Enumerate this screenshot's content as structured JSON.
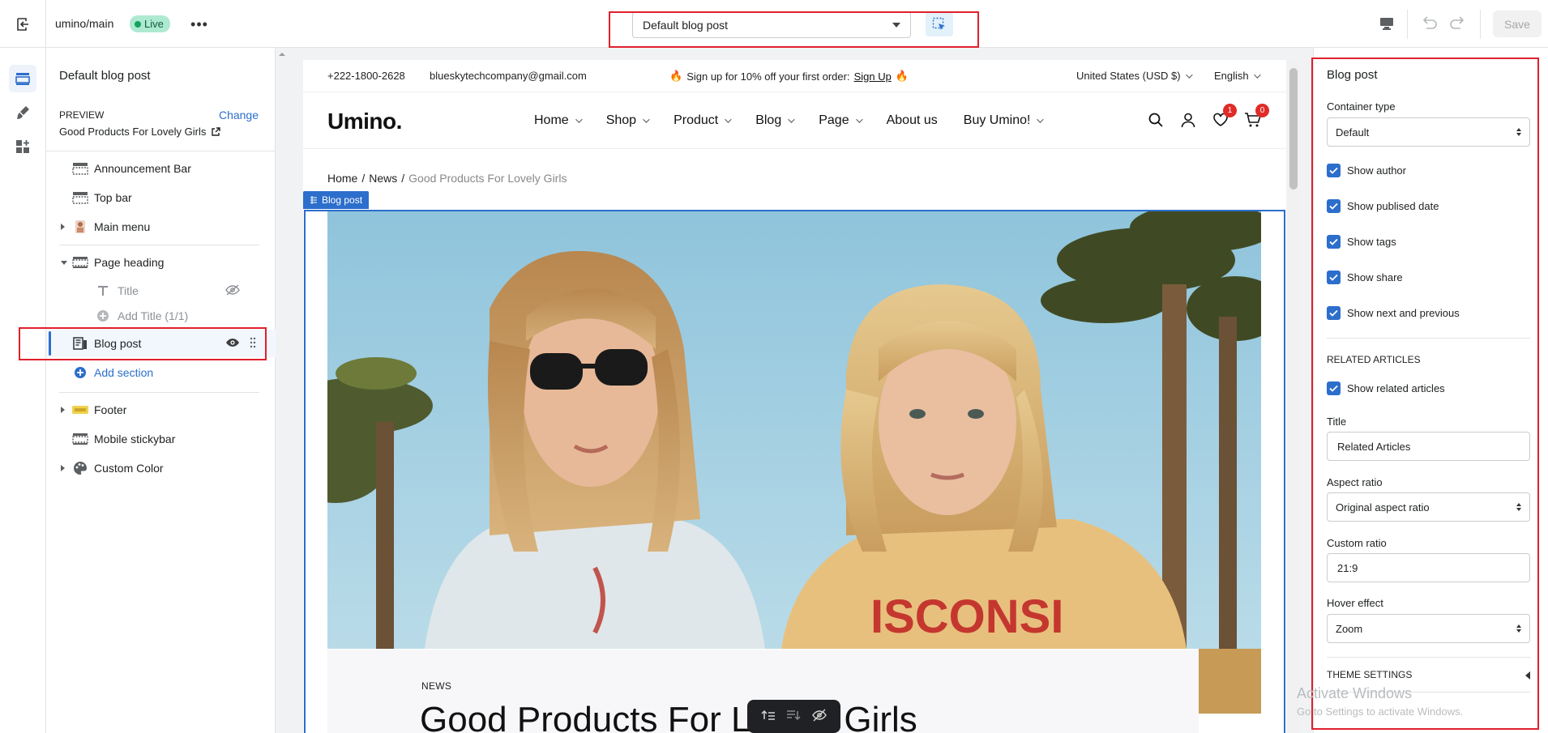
{
  "topbar": {
    "store_name": "umino/main",
    "live_badge": "Live",
    "template": "Default blog post",
    "save_label": "Save"
  },
  "sidebar": {
    "title": "Default blog post",
    "preview_label": "PREVIEW",
    "change_label": "Change",
    "preview_value": "Good Products For Lovely Girls",
    "items": [
      {
        "label": "Announcement Bar"
      },
      {
        "label": "Top bar"
      },
      {
        "label": "Main menu"
      },
      {
        "label": "Page heading"
      },
      {
        "label": "Title"
      },
      {
        "label": "Add Title (1/1)"
      },
      {
        "label": "Blog post"
      },
      {
        "label": "Add section"
      },
      {
        "label": "Footer"
      },
      {
        "label": "Mobile stickybar"
      },
      {
        "label": "Custom Color"
      }
    ]
  },
  "preview": {
    "phone": "+222-1800-2628",
    "email": "blueskytechcompany@gmail.com",
    "promo_text": "Sign up for 10% off your first order:",
    "promo_link": "Sign Up",
    "currency": "United States (USD $)",
    "language": "English",
    "logo": "Umino.",
    "nav": [
      "Home",
      "Shop",
      "Product",
      "Blog",
      "Page",
      "About us",
      "Buy Umino!"
    ],
    "wishlist_count": "1",
    "cart_count": "0",
    "breadcrumb": {
      "home": "Home",
      "sep1": "/",
      "news": "News",
      "sep2": "/",
      "current": "Good Products For Lovely Girls"
    },
    "section_tag": "Blog post",
    "article_category": "NEWS",
    "article_title": "Good Products For Lovely Girls"
  },
  "settings": {
    "title": "Blog post",
    "container_type_label": "Container type",
    "container_type_value": "Default",
    "checks": [
      {
        "label": "Show author",
        "checked": true
      },
      {
        "label": "Show publised date",
        "checked": true
      },
      {
        "label": "Show tags",
        "checked": true
      },
      {
        "label": "Show share",
        "checked": true
      },
      {
        "label": "Show next and previous",
        "checked": true
      }
    ],
    "related_heading": "RELATED ARTICLES",
    "show_related_label": "Show related articles",
    "title_label": "Title",
    "title_value": "Related Articles",
    "aspect_ratio_label": "Aspect ratio",
    "aspect_ratio_value": "Original aspect ratio",
    "custom_ratio_label": "Custom ratio",
    "custom_ratio_value": "21:9",
    "hover_effect_label": "Hover effect",
    "hover_effect_value": "Zoom",
    "theme_settings": "THEME SETTINGS"
  },
  "watermark": {
    "line1": "Activate Windows",
    "line2": "Go to Settings to activate Windows."
  },
  "colors": {
    "accent": "#2c6ecb",
    "highlight": "#e0202c",
    "live_badge_bg": "#aee9d1"
  }
}
